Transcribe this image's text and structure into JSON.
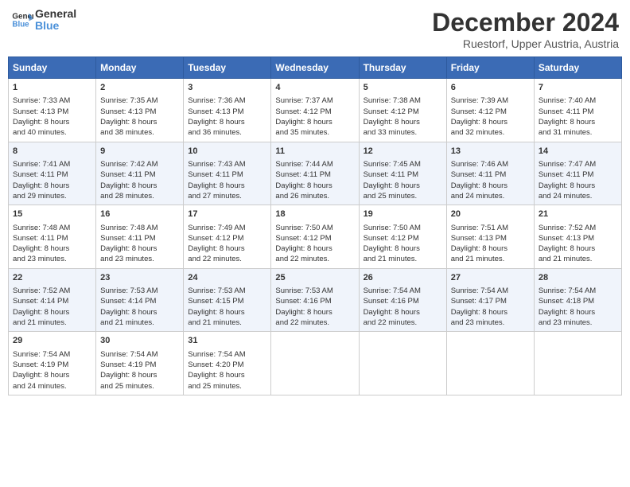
{
  "header": {
    "logo_line1": "General",
    "logo_line2": "Blue",
    "title": "December 2024",
    "subtitle": "Ruestorf, Upper Austria, Austria"
  },
  "columns": [
    "Sunday",
    "Monday",
    "Tuesday",
    "Wednesday",
    "Thursday",
    "Friday",
    "Saturday"
  ],
  "weeks": [
    [
      {
        "day": "1",
        "lines": [
          "Sunrise: 7:33 AM",
          "Sunset: 4:13 PM",
          "Daylight: 8 hours",
          "and 40 minutes."
        ]
      },
      {
        "day": "2",
        "lines": [
          "Sunrise: 7:35 AM",
          "Sunset: 4:13 PM",
          "Daylight: 8 hours",
          "and 38 minutes."
        ]
      },
      {
        "day": "3",
        "lines": [
          "Sunrise: 7:36 AM",
          "Sunset: 4:13 PM",
          "Daylight: 8 hours",
          "and 36 minutes."
        ]
      },
      {
        "day": "4",
        "lines": [
          "Sunrise: 7:37 AM",
          "Sunset: 4:12 PM",
          "Daylight: 8 hours",
          "and 35 minutes."
        ]
      },
      {
        "day": "5",
        "lines": [
          "Sunrise: 7:38 AM",
          "Sunset: 4:12 PM",
          "Daylight: 8 hours",
          "and 33 minutes."
        ]
      },
      {
        "day": "6",
        "lines": [
          "Sunrise: 7:39 AM",
          "Sunset: 4:12 PM",
          "Daylight: 8 hours",
          "and 32 minutes."
        ]
      },
      {
        "day": "7",
        "lines": [
          "Sunrise: 7:40 AM",
          "Sunset: 4:11 PM",
          "Daylight: 8 hours",
          "and 31 minutes."
        ]
      }
    ],
    [
      {
        "day": "8",
        "lines": [
          "Sunrise: 7:41 AM",
          "Sunset: 4:11 PM",
          "Daylight: 8 hours",
          "and 29 minutes."
        ]
      },
      {
        "day": "9",
        "lines": [
          "Sunrise: 7:42 AM",
          "Sunset: 4:11 PM",
          "Daylight: 8 hours",
          "and 28 minutes."
        ]
      },
      {
        "day": "10",
        "lines": [
          "Sunrise: 7:43 AM",
          "Sunset: 4:11 PM",
          "Daylight: 8 hours",
          "and 27 minutes."
        ]
      },
      {
        "day": "11",
        "lines": [
          "Sunrise: 7:44 AM",
          "Sunset: 4:11 PM",
          "Daylight: 8 hours",
          "and 26 minutes."
        ]
      },
      {
        "day": "12",
        "lines": [
          "Sunrise: 7:45 AM",
          "Sunset: 4:11 PM",
          "Daylight: 8 hours",
          "and 25 minutes."
        ]
      },
      {
        "day": "13",
        "lines": [
          "Sunrise: 7:46 AM",
          "Sunset: 4:11 PM",
          "Daylight: 8 hours",
          "and 24 minutes."
        ]
      },
      {
        "day": "14",
        "lines": [
          "Sunrise: 7:47 AM",
          "Sunset: 4:11 PM",
          "Daylight: 8 hours",
          "and 24 minutes."
        ]
      }
    ],
    [
      {
        "day": "15",
        "lines": [
          "Sunrise: 7:48 AM",
          "Sunset: 4:11 PM",
          "Daylight: 8 hours",
          "and 23 minutes."
        ]
      },
      {
        "day": "16",
        "lines": [
          "Sunrise: 7:48 AM",
          "Sunset: 4:11 PM",
          "Daylight: 8 hours",
          "and 23 minutes."
        ]
      },
      {
        "day": "17",
        "lines": [
          "Sunrise: 7:49 AM",
          "Sunset: 4:12 PM",
          "Daylight: 8 hours",
          "and 22 minutes."
        ]
      },
      {
        "day": "18",
        "lines": [
          "Sunrise: 7:50 AM",
          "Sunset: 4:12 PM",
          "Daylight: 8 hours",
          "and 22 minutes."
        ]
      },
      {
        "day": "19",
        "lines": [
          "Sunrise: 7:50 AM",
          "Sunset: 4:12 PM",
          "Daylight: 8 hours",
          "and 21 minutes."
        ]
      },
      {
        "day": "20",
        "lines": [
          "Sunrise: 7:51 AM",
          "Sunset: 4:13 PM",
          "Daylight: 8 hours",
          "and 21 minutes."
        ]
      },
      {
        "day": "21",
        "lines": [
          "Sunrise: 7:52 AM",
          "Sunset: 4:13 PM",
          "Daylight: 8 hours",
          "and 21 minutes."
        ]
      }
    ],
    [
      {
        "day": "22",
        "lines": [
          "Sunrise: 7:52 AM",
          "Sunset: 4:14 PM",
          "Daylight: 8 hours",
          "and 21 minutes."
        ]
      },
      {
        "day": "23",
        "lines": [
          "Sunrise: 7:53 AM",
          "Sunset: 4:14 PM",
          "Daylight: 8 hours",
          "and 21 minutes."
        ]
      },
      {
        "day": "24",
        "lines": [
          "Sunrise: 7:53 AM",
          "Sunset: 4:15 PM",
          "Daylight: 8 hours",
          "and 21 minutes."
        ]
      },
      {
        "day": "25",
        "lines": [
          "Sunrise: 7:53 AM",
          "Sunset: 4:16 PM",
          "Daylight: 8 hours",
          "and 22 minutes."
        ]
      },
      {
        "day": "26",
        "lines": [
          "Sunrise: 7:54 AM",
          "Sunset: 4:16 PM",
          "Daylight: 8 hours",
          "and 22 minutes."
        ]
      },
      {
        "day": "27",
        "lines": [
          "Sunrise: 7:54 AM",
          "Sunset: 4:17 PM",
          "Daylight: 8 hours",
          "and 23 minutes."
        ]
      },
      {
        "day": "28",
        "lines": [
          "Sunrise: 7:54 AM",
          "Sunset: 4:18 PM",
          "Daylight: 8 hours",
          "and 23 minutes."
        ]
      }
    ],
    [
      {
        "day": "29",
        "lines": [
          "Sunrise: 7:54 AM",
          "Sunset: 4:19 PM",
          "Daylight: 8 hours",
          "and 24 minutes."
        ]
      },
      {
        "day": "30",
        "lines": [
          "Sunrise: 7:54 AM",
          "Sunset: 4:19 PM",
          "Daylight: 8 hours",
          "and 25 minutes."
        ]
      },
      {
        "day": "31",
        "lines": [
          "Sunrise: 7:54 AM",
          "Sunset: 4:20 PM",
          "Daylight: 8 hours",
          "and 25 minutes."
        ]
      },
      {
        "day": "",
        "lines": []
      },
      {
        "day": "",
        "lines": []
      },
      {
        "day": "",
        "lines": []
      },
      {
        "day": "",
        "lines": []
      }
    ]
  ]
}
